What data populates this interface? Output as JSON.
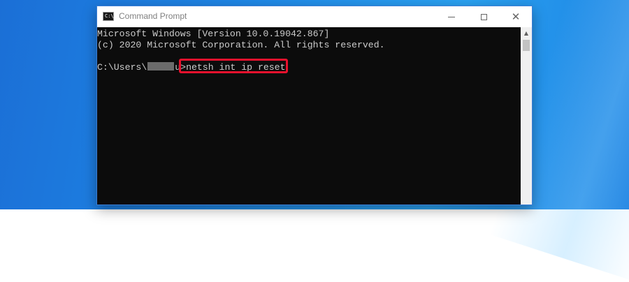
{
  "window": {
    "title": "Command Prompt",
    "icon": "cmd-icon",
    "icon_text": "C:\\_",
    "controls": {
      "minimize_icon": "minimize-icon",
      "maximize_icon": "maximize-icon",
      "close_icon": "close-icon",
      "close_glyph": "✕"
    }
  },
  "console": {
    "line1": "Microsoft Windows [Version 10.0.19042.867]",
    "line2": "(c) 2020 Microsoft Corporation. All rights reserved.",
    "prompt_prefix": "C:\\Users\\",
    "prompt_suffix": "u>",
    "command": "netsh int ip reset",
    "highlight_color": "#e8112d",
    "background_color": "#0c0c0c",
    "text_color": "#cccccc"
  },
  "scrollbar": {
    "up_arrow": "▲"
  }
}
